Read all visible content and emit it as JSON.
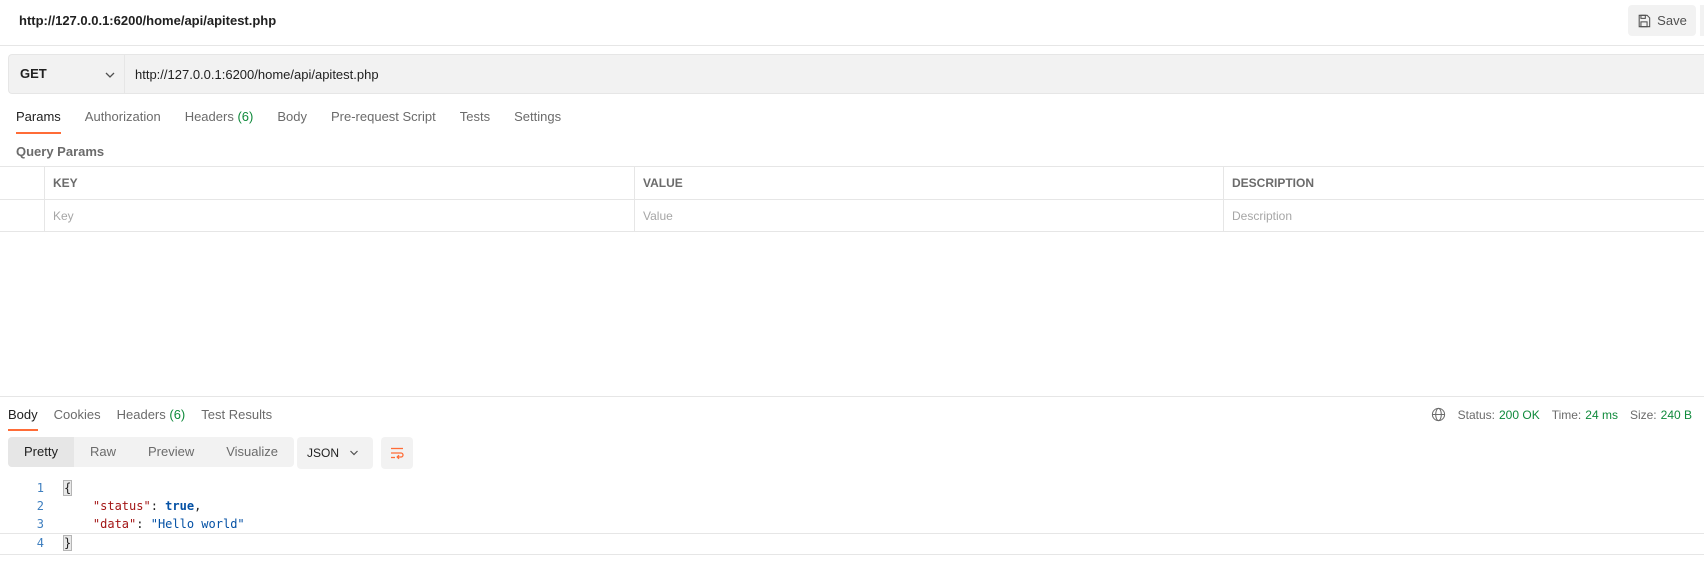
{
  "request": {
    "title": "http://127.0.0.1:6200/home/api/apitest.php",
    "save_label": "Save",
    "method": "GET",
    "url": "http://127.0.0.1:6200/home/api/apitest.php"
  },
  "request_tabs": [
    {
      "label": "Params",
      "active": true
    },
    {
      "label": "Authorization"
    },
    {
      "label": "Headers",
      "count": "(6)"
    },
    {
      "label": "Body"
    },
    {
      "label": "Pre-request Script"
    },
    {
      "label": "Tests"
    },
    {
      "label": "Settings"
    }
  ],
  "query_params": {
    "label": "Query Params",
    "headers": {
      "key": "KEY",
      "value": "VALUE",
      "description": "DESCRIPTION"
    },
    "placeholders": {
      "key": "Key",
      "value": "Value",
      "description": "Description"
    }
  },
  "response": {
    "tabs": [
      {
        "label": "Body",
        "active": true
      },
      {
        "label": "Cookies"
      },
      {
        "label": "Headers",
        "count": "(6)"
      },
      {
        "label": "Test Results"
      }
    ],
    "status_label": "Status:",
    "status_value": "200 OK",
    "time_label": "Time:",
    "time_value": "24 ms",
    "size_label": "Size:",
    "size_value": "240 B",
    "views": [
      "Pretty",
      "Raw",
      "Preview",
      "Visualize"
    ],
    "format": "JSON",
    "code_lines": [
      {
        "n": "1",
        "open": "{"
      },
      {
        "n": "2",
        "key": "\"status\"",
        "sep": ": ",
        "val": "true",
        "tail": ","
      },
      {
        "n": "3",
        "key": "\"data\"",
        "sep": ": ",
        "val": "\"Hello world\""
      },
      {
        "n": "4",
        "close": "}"
      }
    ]
  },
  "colors": {
    "accent": "#ff6c37",
    "success": "#0f8a3b",
    "json_key": "#a31515",
    "json_value": "#0451a5"
  }
}
